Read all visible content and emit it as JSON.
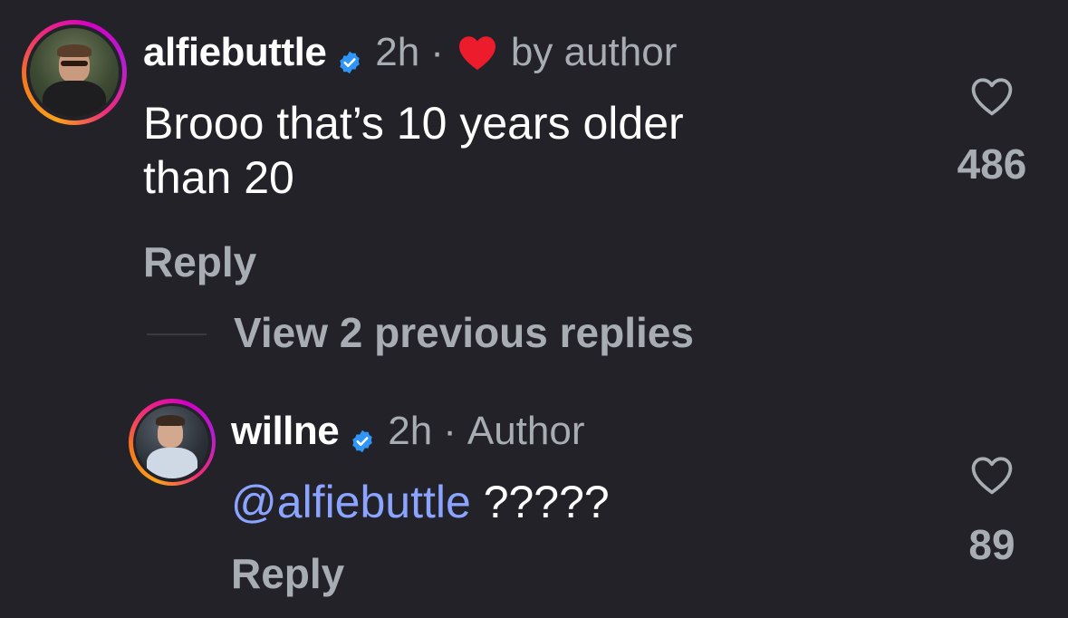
{
  "colors": {
    "background": "#222228",
    "secondary_text": "#a8acb3",
    "mention": "#8aa4ff",
    "verified": "#2f95f6",
    "liked_heart": "#ed1c2c"
  },
  "comments": [
    {
      "username": "alfiebuttle",
      "verified": true,
      "time": "2h",
      "separator": "·",
      "badge_icon": "red-heart-icon",
      "badge_text": "by author",
      "text_line1": "Brooo that’s 10 years older",
      "text_line2": "than 20",
      "reply_label": "Reply",
      "like_count": "486"
    },
    {
      "username": "willne",
      "verified": true,
      "time": "2h",
      "separator": "·",
      "badge_text": "Author",
      "mention": "@alfiebuttle",
      "text_rest": " ?????",
      "reply_label": "Reply",
      "like_count": "89"
    }
  ],
  "view_replies_label": "View 2 previous replies"
}
